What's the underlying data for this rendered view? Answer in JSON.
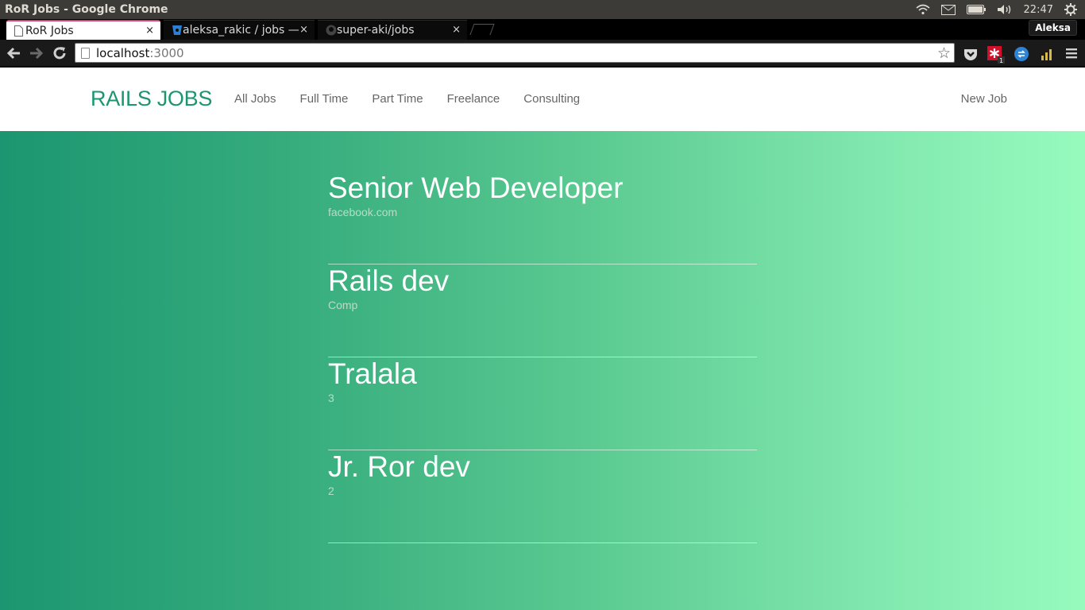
{
  "os": {
    "window_title": "RoR Jobs - Google Chrome",
    "clock": "22:47"
  },
  "browser": {
    "tabs": [
      {
        "label": "RoR Jobs",
        "close": "×",
        "active": true
      },
      {
        "label": "aleksa_rakic / jobs —",
        "close": "×",
        "active": false
      },
      {
        "label": "super-aki/jobs",
        "close": "×",
        "active": false
      }
    ],
    "profile_name": "Aleksa",
    "url_host": "localhost",
    "url_port": ":3000",
    "extension_badge": "1"
  },
  "app": {
    "brand": "RAILS JOBS",
    "nav": [
      "All Jobs",
      "Full Time",
      "Part Time",
      "Freelance",
      "Consulting"
    ],
    "new_job": "New Job",
    "jobs": [
      {
        "title": "Senior Web Developer",
        "company": "facebook.com"
      },
      {
        "title": "Rails dev",
        "company": "Comp"
      },
      {
        "title": "Tralala",
        "company": "3"
      },
      {
        "title": "Jr. Ror dev",
        "company": "2"
      }
    ]
  },
  "colors": {
    "accent": "#1b9670",
    "gradient_start": "#1b9670",
    "gradient_end": "#96fbbd",
    "active_tab_marker": "#d6436e"
  }
}
